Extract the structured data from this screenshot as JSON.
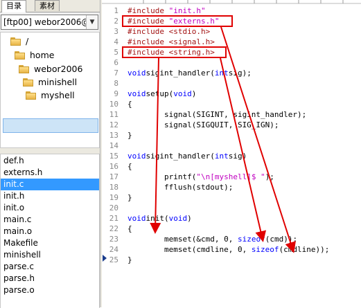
{
  "left_panel": {
    "tabs": [
      {
        "label": "目录",
        "active": true
      },
      {
        "label": "素材",
        "active": false
      }
    ],
    "server_combo": {
      "value": "[ftp00] webor2006@"
    },
    "tree": [
      {
        "label": "/",
        "level": 0
      },
      {
        "label": "home",
        "level": 1
      },
      {
        "label": "webor2006",
        "level": 2
      },
      {
        "label": "minishell",
        "level": 3
      },
      {
        "label": "myshell",
        "level": 4,
        "selected": true
      }
    ],
    "files": [
      "def.h",
      "externs.h",
      "init.c",
      "init.h",
      "init.o",
      "main.c",
      "main.o",
      "Makefile",
      "minishell",
      "parse.c",
      "parse.h",
      "parse.o"
    ],
    "selected_file": "init.c"
  },
  "editor": {
    "line_numbers": [
      "1",
      "2",
      "3",
      "4",
      "5",
      "6",
      "7",
      "8",
      "9",
      "10",
      "11",
      "12",
      "13",
      "14",
      "15",
      "16",
      "17",
      "18",
      "19",
      "20",
      "21",
      "22",
      "23",
      "24",
      "25"
    ],
    "lines": [
      [
        [
          "pp",
          "#include "
        ],
        [
          "str",
          "\"init.h\""
        ]
      ],
      [
        [
          "pp",
          "#include "
        ],
        [
          "str",
          "\"externs.h\""
        ]
      ],
      [
        [
          "pp",
          "#include <stdio.h>"
        ]
      ],
      [
        [
          "pp",
          "#include <signal.h>"
        ]
      ],
      [
        [
          "pp",
          "#include <string.h>"
        ]
      ],
      [],
      [
        [
          "kw",
          "void"
        ],
        [
          "",
          "sigint_handler("
        ],
        [
          "kw",
          "int"
        ],
        [
          "",
          "sig);"
        ]
      ],
      [],
      [
        [
          "kw",
          "void"
        ],
        [
          "",
          "setup("
        ],
        [
          "kw",
          "void"
        ],
        [
          "",
          ")"
        ]
      ],
      [
        [
          "",
          "{"
        ]
      ],
      [
        [
          "",
          "        signal(SIGINT, sigint_handler);"
        ]
      ],
      [
        [
          "",
          "        signal(SIGQUIT, SIG_IGN);"
        ]
      ],
      [
        [
          "",
          "}"
        ]
      ],
      [],
      [
        [
          "kw",
          "void"
        ],
        [
          "",
          "sigint_handler("
        ],
        [
          "kw",
          "int"
        ],
        [
          "",
          "sig)"
        ]
      ],
      [
        [
          "",
          "{"
        ]
      ],
      [
        [
          "",
          "        printf("
        ],
        [
          "str",
          "\"\\n[myshell]$ \""
        ],
        [
          "",
          ");"
        ]
      ],
      [
        [
          "",
          "        fflush(stdout);"
        ]
      ],
      [
        [
          "",
          "}"
        ]
      ],
      [],
      [
        [
          "kw",
          "void"
        ],
        [
          "",
          "init("
        ],
        [
          "kw",
          "void"
        ],
        [
          "",
          ")"
        ]
      ],
      [
        [
          "",
          "{"
        ]
      ],
      [
        [
          "",
          "        memset(&cmd, 0, "
        ],
        [
          "kw",
          "sizeof"
        ],
        [
          "",
          "(cmd));"
        ]
      ],
      [
        [
          "",
          "        memset(cmdline, 0, "
        ],
        [
          "kw",
          "sizeof"
        ],
        [
          "",
          "(cmdline));"
        ]
      ],
      [
        [
          "",
          "}"
        ]
      ]
    ],
    "current_line": "25",
    "annotation_color": "#e00000"
  }
}
